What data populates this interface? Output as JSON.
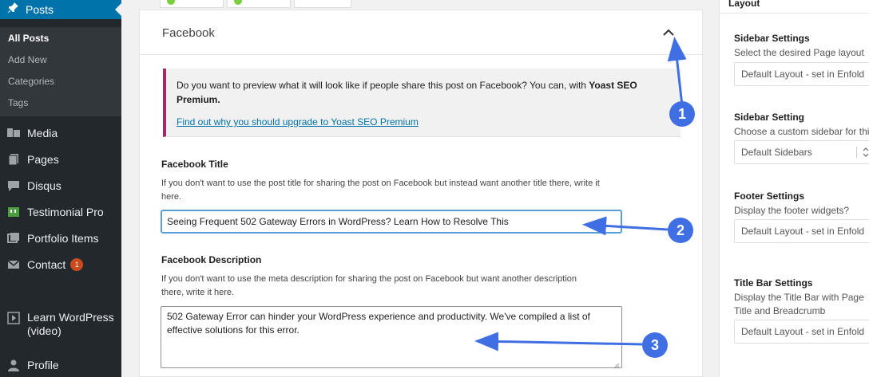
{
  "sidebar": {
    "active_menu": "Posts",
    "submenu": [
      "All Posts",
      "Add New",
      "Categories",
      "Tags"
    ],
    "items": [
      {
        "label": "Media",
        "icon": "media-icon"
      },
      {
        "label": "Pages",
        "icon": "pages-icon"
      },
      {
        "label": "Disqus",
        "icon": "comment-icon"
      },
      {
        "label": "Testimonial Pro",
        "icon": "testimonial-icon"
      },
      {
        "label": "Portfolio Items",
        "icon": "portfolio-icon"
      },
      {
        "label": "Contact",
        "icon": "envelope-icon",
        "badge": "1"
      },
      {
        "label": "Learn WordPress (video)",
        "icon": "video-icon"
      },
      {
        "label": "Profile",
        "icon": "user-icon"
      }
    ]
  },
  "main": {
    "facebook": {
      "heading": "Facebook",
      "notice_text": "Do you want to preview what it will look like if people share this post on Facebook? You can, with",
      "notice_bold": "Yoast SEO Premium.",
      "notice_link": "Find out why you should upgrade to Yoast SEO Premium",
      "title_label": "Facebook Title",
      "title_help": "If you don't want to use the post title for sharing the post on Facebook but instead want another title there, write it here.",
      "title_value": "Seeing Frequent 502 Gateway Errors in WordPress? Learn How to Resolve This",
      "desc_label": "Facebook Description",
      "desc_help": "If you don't want to use the meta description for sharing the post on Facebook but want another description there, write it here.",
      "desc_value": "502 Gateway Error can hinder your WordPress experience and productivity. We've compiled a list of effective solutions for this error."
    }
  },
  "right_panel": {
    "header": "Layout",
    "sections": [
      {
        "title": "Sidebar Settings",
        "desc": "Select the desired Page layout",
        "select": "Default Layout - set in Enfold"
      },
      {
        "title": "Sidebar Setting",
        "desc": "Choose a custom sidebar for this",
        "select": "Default Sidebars"
      },
      {
        "title": "Footer Settings",
        "desc": "Display the footer widgets?",
        "select": "Default Layout - set in Enfold"
      },
      {
        "title": "Title Bar Settings",
        "desc": "Display the Title Bar with Page Title and Breadcrumb Navigation?",
        "select": "Default Layout - set in Enfold"
      }
    ]
  },
  "annotations": [
    "1",
    "2",
    "3"
  ],
  "colors": {
    "sidebar_bg": "#23282d",
    "sidebar_active": "#0073aa",
    "notice_border": "#a4286a",
    "link": "#0073aa",
    "annotation": "#3f6fe3",
    "focus_border": "#5b9dd9"
  }
}
